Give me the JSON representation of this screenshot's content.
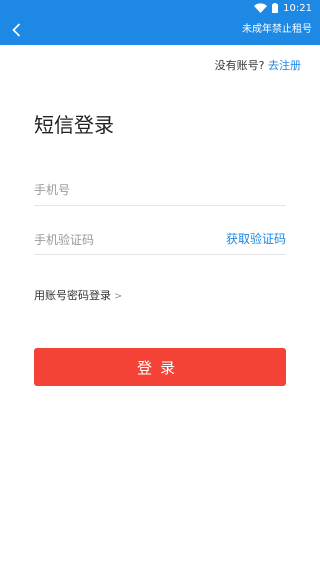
{
  "status_bar": {
    "time": "10:21",
    "icons": [
      "wifi-icon",
      "battery-icon"
    ]
  },
  "header": {
    "back_icon": "chevron-left-icon",
    "right_text": "未成年禁止租号",
    "background": "#1e88e5"
  },
  "signup": {
    "prompt": "没有账号?",
    "link": "去注册"
  },
  "page_title": "短信登录",
  "phone_field": {
    "placeholder": "手机号",
    "value": ""
  },
  "code_field": {
    "placeholder": "手机验证码",
    "value": "",
    "action": "获取验证码"
  },
  "password_login": {
    "label": "用账号密码登录",
    "chevron": ">"
  },
  "login_button": {
    "label": "登录",
    "color": "#f44336"
  },
  "colors": {
    "accent": "#1e88e5",
    "primary_button": "#f44336"
  }
}
